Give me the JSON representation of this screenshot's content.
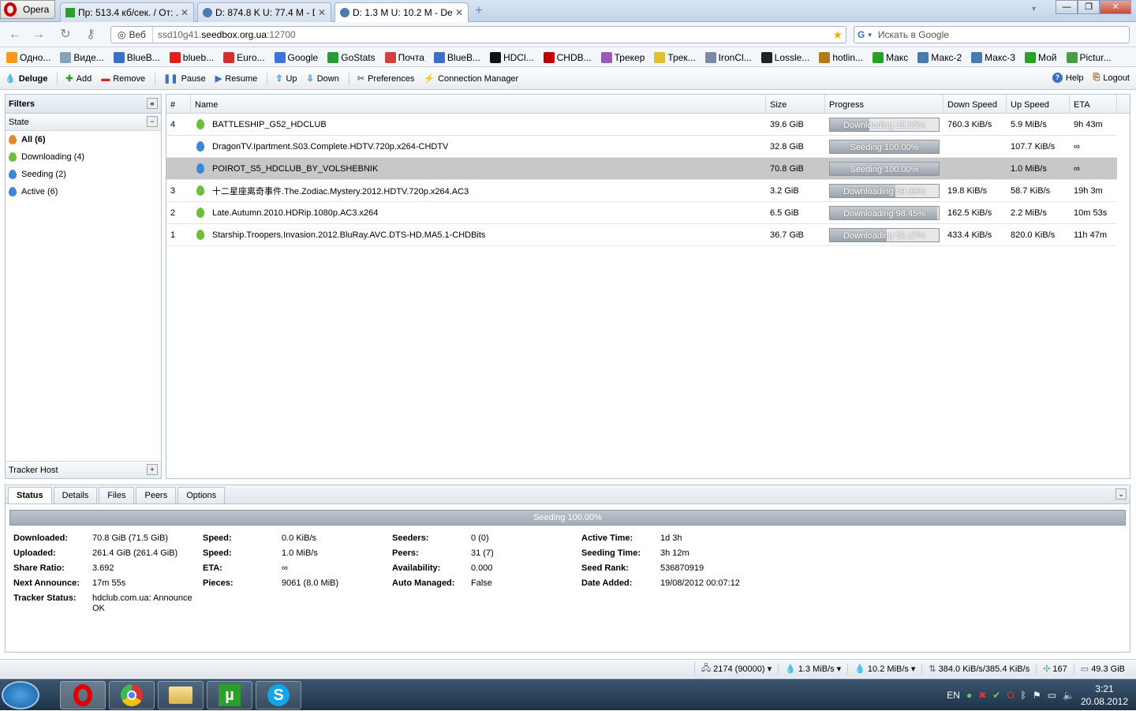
{
  "browser": {
    "menu_label": "Opera",
    "tabs": [
      {
        "label": "Пр: 513.4 кб/сек. / От: ...",
        "active": false
      },
      {
        "label": "D: 874.8 K U: 77.4 M - D...",
        "active": false
      },
      {
        "label": "D: 1.3 M U: 10.2 M - Del...",
        "active": true
      }
    ],
    "address": {
      "chip": "Веб",
      "url_prefix": "ssd10g41.",
      "url_host": "seedbox.org.ua",
      "url_suffix": ":12700"
    },
    "search_placeholder": "Искать в Google",
    "bookmarks": [
      {
        "label": "Одно...",
        "color": "#f59a1b"
      },
      {
        "label": "Виде...",
        "color": "#8aa0b8"
      },
      {
        "label": "BlueB...",
        "color": "#3a6fc4"
      },
      {
        "label": "blueb...",
        "color": "#e02020"
      },
      {
        "label": "Euro...",
        "color": "#d03030"
      },
      {
        "label": "Google",
        "color": "#3b73d8"
      },
      {
        "label": "GoStats",
        "color": "#2a9b3a"
      },
      {
        "label": "Почта",
        "color": "#d04040"
      },
      {
        "label": "BlueB...",
        "color": "#3a6fc4"
      },
      {
        "label": "HDCl...",
        "color": "#111111"
      },
      {
        "label": "CHDB...",
        "color": "#c00000"
      },
      {
        "label": "Трекер",
        "color": "#9b59b6"
      },
      {
        "label": "Трек...",
        "color": "#e0c030"
      },
      {
        "label": "IronCl...",
        "color": "#7a8aa0"
      },
      {
        "label": "Lossle...",
        "color": "#222222"
      },
      {
        "label": "hotlin...",
        "color": "#b07a20"
      },
      {
        "label": "Макс",
        "color": "#2aa02a"
      },
      {
        "label": "Макс-2",
        "color": "#4a7ab0"
      },
      {
        "label": "Макс-3",
        "color": "#4a7ab0"
      },
      {
        "label": "Мой",
        "color": "#2aa02a"
      },
      {
        "label": "Pictur...",
        "color": "#4a9a4a"
      }
    ]
  },
  "toolbar": {
    "app_label": "Deluge",
    "add": "Add",
    "remove": "Remove",
    "pause": "Pause",
    "resume": "Resume",
    "up": "Up",
    "down": "Down",
    "preferences": "Preferences",
    "connection_manager": "Connection Manager",
    "help": "Help",
    "logout": "Logout"
  },
  "filters": {
    "title": "Filters",
    "state_title": "State",
    "items": [
      {
        "label": "All (6)",
        "color": "#e08a2a",
        "selected": true
      },
      {
        "label": "Downloading (4)",
        "color": "#6cbf3a",
        "selected": false
      },
      {
        "label": "Seeding (2)",
        "color": "#3a88d8",
        "selected": false
      },
      {
        "label": "Active (6)",
        "color": "#3a88d8",
        "selected": false
      }
    ],
    "tracker_title": "Tracker Host"
  },
  "grid": {
    "headers": [
      "#",
      "Name",
      "Size",
      "Progress",
      "Down Speed",
      "Up Speed",
      "ETA"
    ],
    "rows": [
      {
        "num": "4",
        "name": "BATTLESHIP_G52_HDCLUB",
        "size": "39.6 GiB",
        "progress": 0.3593,
        "progress_label": "Downloading 35.93%",
        "down": "760.3 KiB/s",
        "up": "5.9 MiB/s",
        "eta": "9h 43m",
        "state": "downloading",
        "selected": false
      },
      {
        "num": "",
        "name": "DragonTV.Ipartment.S03.Complete.HDTV.720p.x264-CHDTV",
        "size": "32.8 GiB",
        "progress": 1.0,
        "progress_label": "Seeding 100.00%",
        "down": "",
        "up": "107.7 KiB/s",
        "eta": "∞",
        "state": "seeding",
        "selected": false
      },
      {
        "num": "",
        "name": "POIROT_S5_HDCLUB_BY_VOLSHEBNIK",
        "size": "70.8 GiB",
        "progress": 1.0,
        "progress_label": "Seeding 100.00%",
        "down": "",
        "up": "1.0 MiB/s",
        "eta": "∞",
        "state": "seeding",
        "selected": true
      },
      {
        "num": "3",
        "name": "十二星座离奇事件.The.Zodiac.Mystery.2012.HDTV.720p.x264.AC3",
        "size": "3.2 GiB",
        "progress": 0.5999,
        "progress_label": "Downloading 59.99%",
        "down": "19.8 KiB/s",
        "up": "58.7 KiB/s",
        "eta": "19h 3m",
        "state": "downloading",
        "selected": false
      },
      {
        "num": "2",
        "name": "Late.Autumn.2010.HDRip.1080p.AC3.x264",
        "size": "6.5 GiB",
        "progress": 0.9845,
        "progress_label": "Downloading 98.45%",
        "down": "162.5 KiB/s",
        "up": "2.2 MiB/s",
        "eta": "10m 53s",
        "state": "downloading",
        "selected": false
      },
      {
        "num": "1",
        "name": "Starship.Troopers.Invasion.2012.BluRay.AVC.DTS-HD.MA5.1-CHDBits",
        "size": "36.7 GiB",
        "progress": 0.5227,
        "progress_label": "Downloading 52.27%",
        "down": "433.4 KiB/s",
        "up": "820.0 KiB/s",
        "eta": "11h 47m",
        "state": "downloading",
        "selected": false
      }
    ]
  },
  "details": {
    "tabs": [
      "Status",
      "Details",
      "Files",
      "Peers",
      "Options"
    ],
    "bar_label": "Seeding 100.00%",
    "bar_progress": 1.0,
    "col1": [
      {
        "label": "Downloaded:",
        "value": "70.8 GiB (71.5 GiB)"
      },
      {
        "label": "Uploaded:",
        "value": "261.4 GiB (261.4 GiB)"
      },
      {
        "label": "Share Ratio:",
        "value": "3.692"
      },
      {
        "label": "Next Announce:",
        "value": "17m 55s"
      },
      {
        "label": "Tracker Status:",
        "value": "hdclub.com.ua: Announce OK"
      }
    ],
    "col2": [
      {
        "label": "Speed:",
        "value": "0.0 KiB/s"
      },
      {
        "label": "Speed:",
        "value": "1.0 MiB/s"
      },
      {
        "label": "ETA:",
        "value": "∞"
      },
      {
        "label": "Pieces:",
        "value": "9061 (8.0 MiB)"
      }
    ],
    "col3": [
      {
        "label": "Seeders:",
        "value": "0 (0)"
      },
      {
        "label": "Peers:",
        "value": "31 (7)"
      },
      {
        "label": "Availability:",
        "value": "0.000"
      },
      {
        "label": "Auto Managed:",
        "value": "False"
      }
    ],
    "col4": [
      {
        "label": "Active Time:",
        "value": "1d 3h"
      },
      {
        "label": "Seeding Time:",
        "value": "3h 12m"
      },
      {
        "label": "Seed Rank:",
        "value": "536870919"
      },
      {
        "label": "Date Added:",
        "value": "19/08/2012 00:07:12"
      }
    ]
  },
  "statusbar": {
    "connections": "2174 (90000)",
    "down": "1.3 MiB/s",
    "up": "10.2 MiB/s",
    "protocol": "384.0 KiB/s/385.4 KiB/s",
    "dht": "167",
    "free": "49.3 GiB"
  },
  "taskbar": {
    "lang": "EN",
    "time": "3:21",
    "date": "20.08.2012"
  }
}
